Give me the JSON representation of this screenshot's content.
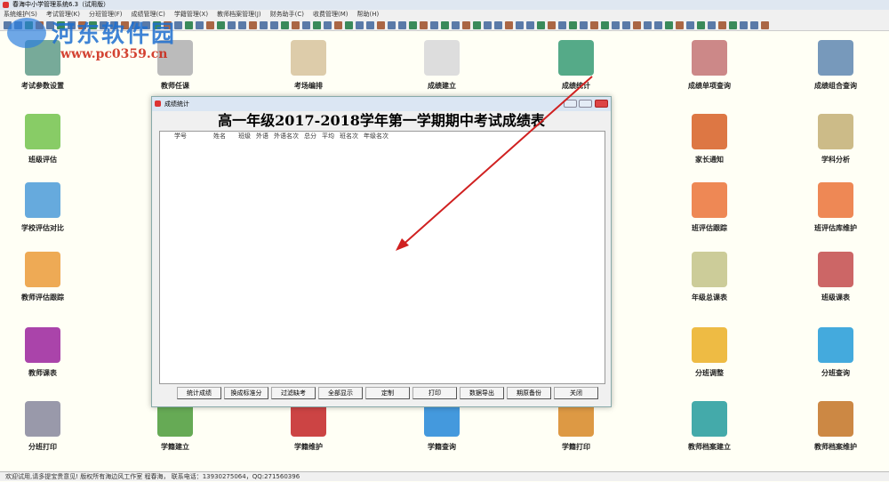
{
  "window": {
    "title": "春海中小学管理系统6.3（试用版）"
  },
  "menu": [
    "系统维护(S)",
    "考试管理(K)",
    "分班管理(F)",
    "成绩管理(C)",
    "学籍管理(X)",
    "教师档案管理(J)",
    "财务助手(C)",
    "收费管理(M)",
    "帮助(H)"
  ],
  "watermark": {
    "name": "河东软件园",
    "url": "www.pc0359.cn"
  },
  "tiles": [
    {
      "label": "考试参数设置",
      "color": "#7a9"
    },
    {
      "label": "班级评估",
      "color": "#8c6"
    },
    {
      "label": "学校评估对比",
      "color": "#6ad"
    },
    {
      "label": "教师评估跟踪",
      "color": "#ea5"
    },
    {
      "label": "教师课表",
      "color": "#a4a"
    },
    {
      "label": "分班打印",
      "color": "#99a"
    },
    {
      "label": "教师任课",
      "color": "#bbb"
    },
    {
      "label": "学籍建立",
      "color": "#6a5"
    },
    {
      "label": "考场编排",
      "color": "#dca"
    },
    {
      "label": "学籍维护",
      "color": "#c44"
    },
    {
      "label": "成绩建立",
      "color": "#ddd"
    },
    {
      "label": "学籍查询",
      "color": "#49d"
    },
    {
      "label": "成绩统计",
      "color": "#5a8"
    },
    {
      "label": "学籍打印",
      "color": "#d94"
    },
    {
      "label": "成绩单项查询",
      "color": "#c88"
    },
    {
      "label": "家长通知",
      "color": "#d74"
    },
    {
      "label": "班评估跟踪",
      "color": "#e85"
    },
    {
      "label": "年级总课表",
      "color": "#cc9"
    },
    {
      "label": "分班调整",
      "color": "#eb4"
    },
    {
      "label": "教师档案建立",
      "color": "#4aa"
    },
    {
      "label": "成绩组合查询",
      "color": "#79b"
    },
    {
      "label": "学科分析",
      "color": "#cb8"
    },
    {
      "label": "班评估库维护",
      "color": "#e85"
    },
    {
      "label": "班级课表",
      "color": "#c66"
    },
    {
      "label": "分班查询",
      "color": "#4ad"
    },
    {
      "label": "教师档案维护",
      "color": "#c84"
    }
  ],
  "dialog": {
    "title": "成绩统计",
    "heading": "高一年级2017-2018学年第一学期期中考试成绩表",
    "columns": [
      "学号",
      "姓名",
      "班级",
      "外语",
      "外语名次",
      "总分",
      "平均",
      "班名次",
      "年级名次"
    ],
    "buttons": [
      "统计成绩",
      "换成标准分",
      "过滤缺考",
      "全部显示",
      "定制",
      "打印",
      "数据导出",
      "期原备份",
      "关闭"
    ]
  },
  "status": "欢迎试用,请多提宝贵意见!  版权所有海边风工作室 程春海，  联系电话：13930275064，QQ:271560396"
}
